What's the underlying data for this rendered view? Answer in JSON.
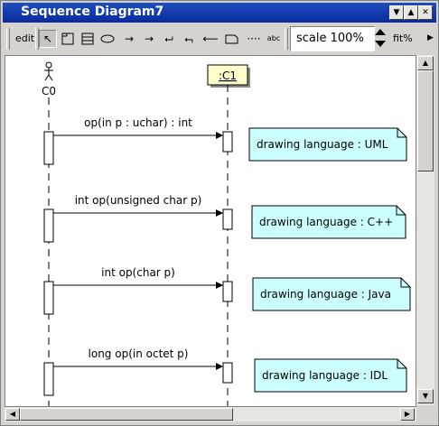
{
  "window": {
    "title": "Sequence Diagram7"
  },
  "toolbar": {
    "edit_label": "edit",
    "scale_label": "scale 100%",
    "fit_label": "fit%",
    "tools": [
      "arrow-pointer",
      "class-box",
      "fragment",
      "usecase-oval",
      "sync-message",
      "async-message",
      "return-message",
      "reflexive-message",
      "lost-message",
      "note",
      "dashed-line",
      "text-abc"
    ],
    "tool_text_abc": "abc"
  },
  "diagram": {
    "actor": {
      "name": "C0"
    },
    "object": {
      "name": ":C1"
    },
    "colors": {
      "object_bg": "#ffffcc",
      "note_bg": "#ccffff"
    },
    "messages": [
      {
        "label": "op(in p : uchar) : int",
        "note": "drawing language : UML"
      },
      {
        "label": "int op(unsigned char p)",
        "note": "drawing language : C++"
      },
      {
        "label": "int op(char p)",
        "note": "drawing language : Java"
      },
      {
        "label": "long op(in octet p)",
        "note": "drawing language : IDL"
      }
    ]
  }
}
